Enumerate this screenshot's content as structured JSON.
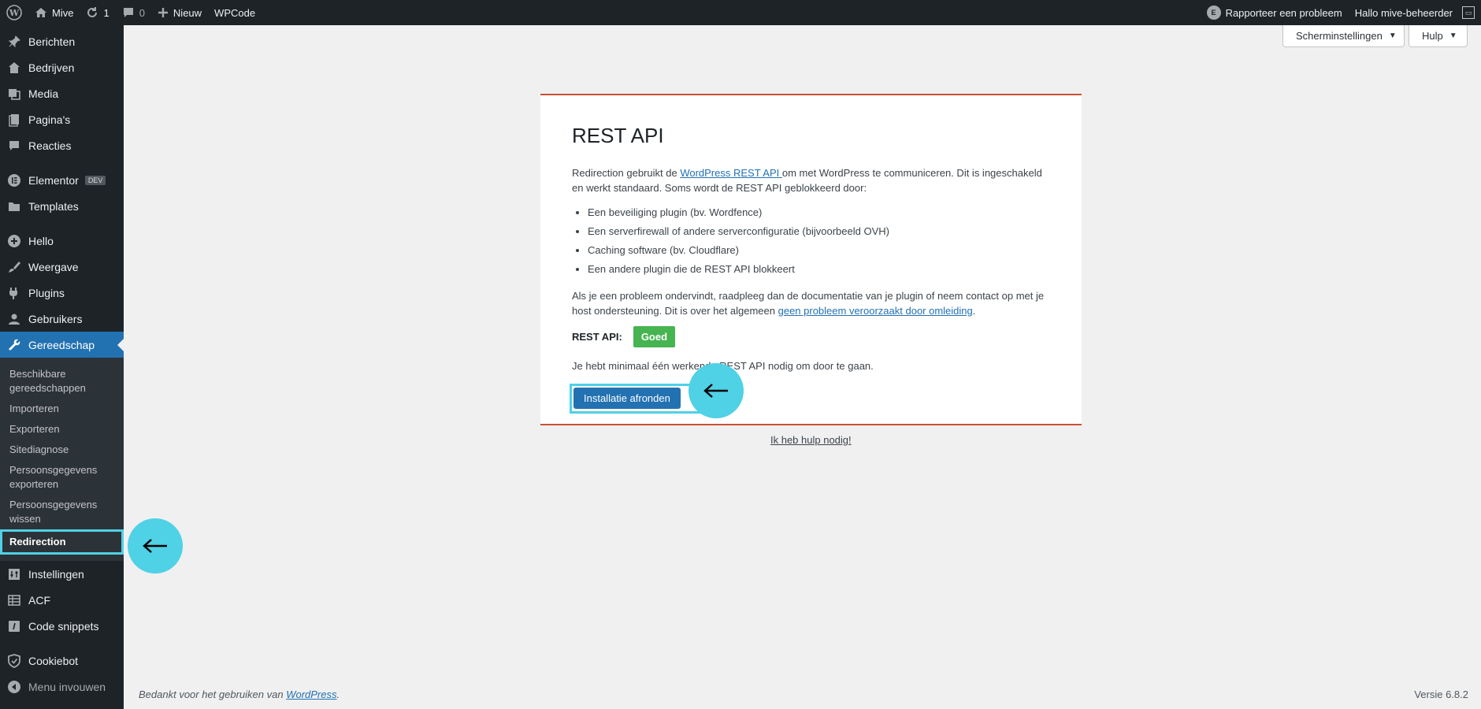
{
  "adminbar": {
    "site_name": "Mive",
    "updates_count": "1",
    "comments_count": "0",
    "new_label": "Nieuw",
    "wpcode_label": "WPCode",
    "report_label": "Rapporteer een probleem",
    "greeting": "Hallo mive-beheerder"
  },
  "sidebar": {
    "items_top": [
      {
        "label": "Berichten",
        "icon": "pin-icon"
      },
      {
        "label": "Bedrijven",
        "icon": "building-icon"
      },
      {
        "label": "Media",
        "icon": "media-icon"
      },
      {
        "label": "Pagina's",
        "icon": "page-icon"
      },
      {
        "label": "Reacties",
        "icon": "comment-icon"
      }
    ],
    "elementor": "Elementor",
    "dev_badge": "DEV",
    "templates": "Templates",
    "items_mid": [
      {
        "label": "Hello",
        "icon": "plus-circle-icon"
      },
      {
        "label": "Weergave",
        "icon": "brush-icon"
      },
      {
        "label": "Plugins",
        "icon": "plugin-icon"
      },
      {
        "label": "Gebruikers",
        "icon": "user-icon"
      }
    ],
    "current": "Gereedschap",
    "submenu": [
      "Beschikbare gereedschappen",
      "Importeren",
      "Exporteren",
      "Sitediagnose",
      "Persoonsgegevens exporteren",
      "Persoonsgegevens wissen"
    ],
    "submenu_active": "Redirection",
    "items_bottom": [
      {
        "label": "Instellingen",
        "icon": "settings-icon"
      },
      {
        "label": "ACF",
        "icon": "table-icon"
      },
      {
        "label": "Code snippets",
        "icon": "code-icon"
      }
    ],
    "cookiebot": "Cookiebot",
    "collapse": "Menu invouwen"
  },
  "screen_options": "Scherminstellingen",
  "help": "Hulp",
  "card": {
    "title": "REST API",
    "intro_before": "Redirection gebruikt de ",
    "intro_link": "WordPress REST API ",
    "intro_after": "om met WordPress te communiceren. Dit is ingeschakeld en werkt standaard. Soms wordt de REST API geblokkeerd door:",
    "bullets": [
      "Een beveiliging plugin (bv. Wordfence)",
      "Een serverfirewall of andere serverconfiguratie (bijvoorbeeld OVH)",
      "Caching software (bv. Cloudflare)",
      "Een andere plugin die de REST API blokkeert"
    ],
    "problem_before": "Als je een probleem ondervindt, raadpleeg dan de documentatie van je plugin of neem contact op met je host ondersteuning. Dit is over het algemeen ",
    "problem_link": "geen probleem veroorzaakt door omleiding",
    "problem_after": ".",
    "status_label": "REST API:",
    "status_value": "Goed",
    "min_note": "Je hebt minimaal één werkende REST API nodig om door te gaan.",
    "button": "Installatie afronden"
  },
  "help_link": "Ik heb hulp nodig!",
  "footer": {
    "thanks_before": "Bedankt voor het gebruiken van ",
    "thanks_link": "WordPress",
    "thanks_after": ".",
    "version": "Versie 6.8.2"
  },
  "colors": {
    "accent": "#2271b1",
    "callout": "#4fd1e6",
    "success": "#46b450",
    "card_border": "#c9512f"
  }
}
